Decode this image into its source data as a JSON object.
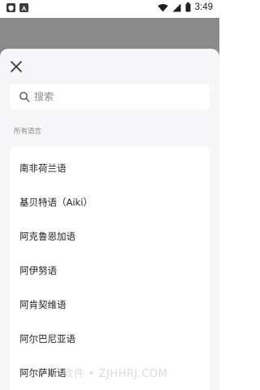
{
  "status_bar": {
    "time": "3:49",
    "left_icons": [
      "shield-notification-icon",
      "text-a-notification-icon"
    ],
    "right_icons": [
      "wifi-icon",
      "signal-icon",
      "battery-icon"
    ]
  },
  "sheet": {
    "close_icon": "close-icon",
    "search": {
      "placeholder": "搜索",
      "value": "",
      "icon": "search-icon"
    },
    "section_label": "所有语言",
    "languages": [
      "南非荷兰语",
      "基贝特语（Aiki）",
      "阿克鲁恩加语",
      "阿伊努语",
      "阿肯契维语",
      "阿尔巴尼亚语",
      "阿尔萨斯语"
    ]
  },
  "watermark": "…软件 • ZJHHRJ.COM",
  "colors": {
    "backdrop": "#8a8a8a",
    "sheet_bg": "#f6f6f8",
    "card_bg": "#ffffff",
    "text": "#222222",
    "muted": "#8a8a8a"
  }
}
